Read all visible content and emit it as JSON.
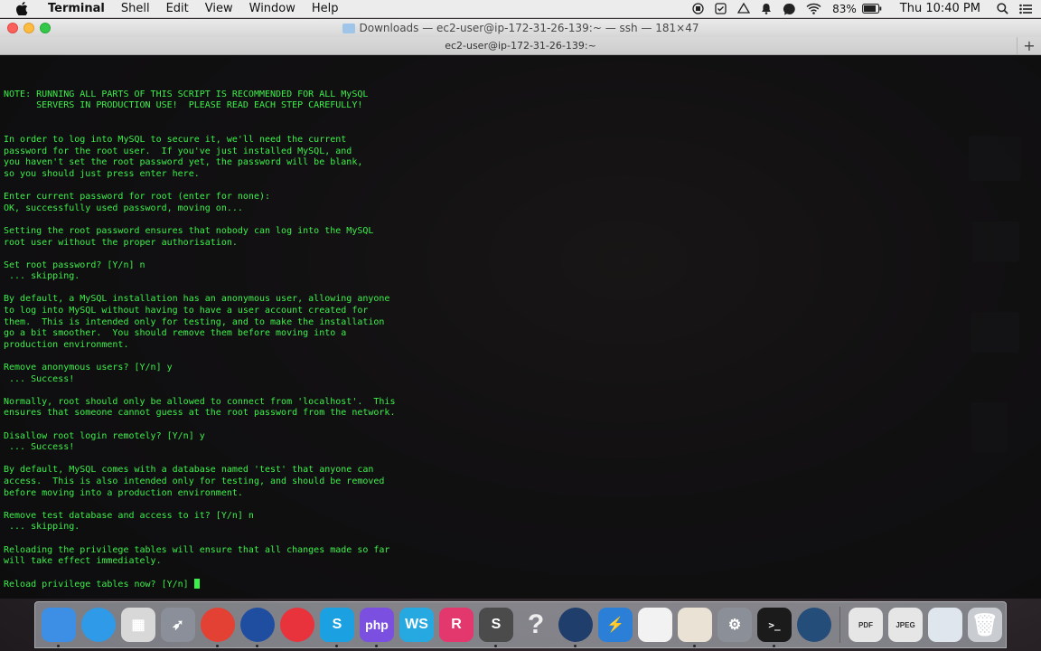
{
  "menubar": {
    "app_name": "Terminal",
    "items": [
      "Shell",
      "Edit",
      "View",
      "Window",
      "Help"
    ],
    "battery_percent": "83%",
    "clock": "Thu 10:40 PM"
  },
  "window": {
    "title": "Downloads — ec2-user@ip-172-31-26-139:~ — ssh — 181×47",
    "tab_title": "ec2-user@ip-172-31-26-139:~",
    "new_tab": "+"
  },
  "terminal": {
    "lines": [
      "",
      "",
      "",
      "NOTE: RUNNING ALL PARTS OF THIS SCRIPT IS RECOMMENDED FOR ALL MySQL",
      "      SERVERS IN PRODUCTION USE!  PLEASE READ EACH STEP CAREFULLY!",
      "",
      "",
      "In order to log into MySQL to secure it, we'll need the current",
      "password for the root user.  If you've just installed MySQL, and",
      "you haven't set the root password yet, the password will be blank,",
      "so you should just press enter here.",
      "",
      "Enter current password for root (enter for none):",
      "OK, successfully used password, moving on...",
      "",
      "Setting the root password ensures that nobody can log into the MySQL",
      "root user without the proper authorisation.",
      "",
      "Set root password? [Y/n] n",
      " ... skipping.",
      "",
      "By default, a MySQL installation has an anonymous user, allowing anyone",
      "to log into MySQL without having to have a user account created for",
      "them.  This is intended only for testing, and to make the installation",
      "go a bit smoother.  You should remove them before moving into a",
      "production environment.",
      "",
      "Remove anonymous users? [Y/n] y",
      " ... Success!",
      "",
      "Normally, root should only be allowed to connect from 'localhost'.  This",
      "ensures that someone cannot guess at the root password from the network.",
      "",
      "Disallow root login remotely? [Y/n] y",
      " ... Success!",
      "",
      "By default, MySQL comes with a database named 'test' that anyone can",
      "access.  This is also intended only for testing, and should be removed",
      "before moving into a production environment.",
      "",
      "Remove test database and access to it? [Y/n] n",
      " ... skipping.",
      "",
      "Reloading the privilege tables will ensure that all changes made so far",
      "will take effect immediately.",
      ""
    ],
    "prompt": "Reload privilege tables now? [Y/n] "
  },
  "dock": {
    "items": [
      {
        "name": "finder-icon",
        "color": "#3d8fe6"
      },
      {
        "name": "safari-icon",
        "color": "#2f9ae8"
      },
      {
        "name": "launchpad-grid-icon",
        "color": "#d8d8d8"
      },
      {
        "name": "rocket-icon",
        "color": "#8a8f9a"
      },
      {
        "name": "chrome-icon",
        "color": "#e34133"
      },
      {
        "name": "firefox-icon",
        "color": "#1f4ea1"
      },
      {
        "name": "vivaldi-icon",
        "color": "#e8323c"
      },
      {
        "name": "skype-icon",
        "color": "#1ba0e1"
      },
      {
        "name": "phpstorm-icon",
        "color": "#7b4fe0"
      },
      {
        "name": "webstorm-icon",
        "color": "#26a8e0"
      },
      {
        "name": "rubymine-icon",
        "color": "#e2386d"
      },
      {
        "name": "sublime-text-icon",
        "color": "#4b4b4b"
      },
      {
        "name": "help-question-icon",
        "color": "#9aa0a8"
      },
      {
        "name": "sourcetree-icon",
        "color": "#1f3e6b"
      },
      {
        "name": "lightning-icon",
        "color": "#2b7fd6"
      },
      {
        "name": "photos-icon",
        "color": "#f2f2f2"
      },
      {
        "name": "popcorn-icon",
        "color": "#e9e2d5"
      },
      {
        "name": "system-preferences-gear-icon",
        "color": "#8b8f97"
      },
      {
        "name": "terminal-icon",
        "color": "#1b1b1b"
      },
      {
        "name": "quicktime-icon",
        "color": "#254d7a"
      },
      {
        "name": "pdf-document-icon",
        "color": "#e6e6e6"
      },
      {
        "name": "jpeg-document-icon",
        "color": "#e6e6e6"
      },
      {
        "name": "screenshot-stack-icon",
        "color": "#dfe6ee"
      },
      {
        "name": "trash-icon",
        "color": "#c9ccd1"
      }
    ],
    "labels": {
      "php": "php",
      "pdf": "PDF",
      "jpeg": "JPEG"
    }
  }
}
